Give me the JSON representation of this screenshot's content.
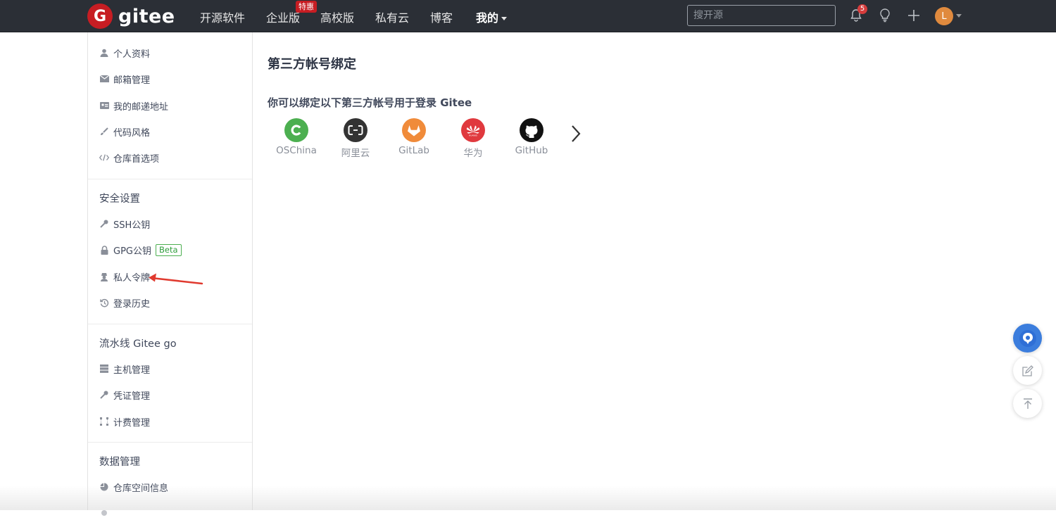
{
  "header": {
    "logo_letter": "G",
    "logo_text": "gitee",
    "nav": [
      "开源软件",
      "企业版",
      "高校版",
      "私有云",
      "博客",
      "我的"
    ],
    "promo_badge": "特惠",
    "search_placeholder": "搜开源",
    "notification_count": "5",
    "avatar_letter": "L"
  },
  "sidebar": {
    "group1": [
      "个人资料",
      "邮箱管理",
      "我的邮递地址",
      "代码风格",
      "仓库首选项"
    ],
    "security_title": "安全设置",
    "security": [
      "SSH公钥",
      "GPG公钥",
      "私人令牌",
      "登录历史"
    ],
    "beta_label": "Beta",
    "pipeline_title": "流水线 Gitee go",
    "pipeline": [
      "主机管理",
      "凭证管理",
      "计费管理"
    ],
    "data_title": "数据管理",
    "data": [
      "仓库空间信息"
    ]
  },
  "main": {
    "title": "第三方帐号绑定",
    "subtitle": "你可以绑定以下第三方帐号用于登录 Gitee",
    "providers": [
      "OSChina",
      "阿里云",
      "GitLab",
      "华为",
      "GitHub"
    ],
    "provider_colors": [
      "#4caf50",
      "#333333",
      "#f08b3a",
      "#e0393e",
      "#111111"
    ]
  }
}
